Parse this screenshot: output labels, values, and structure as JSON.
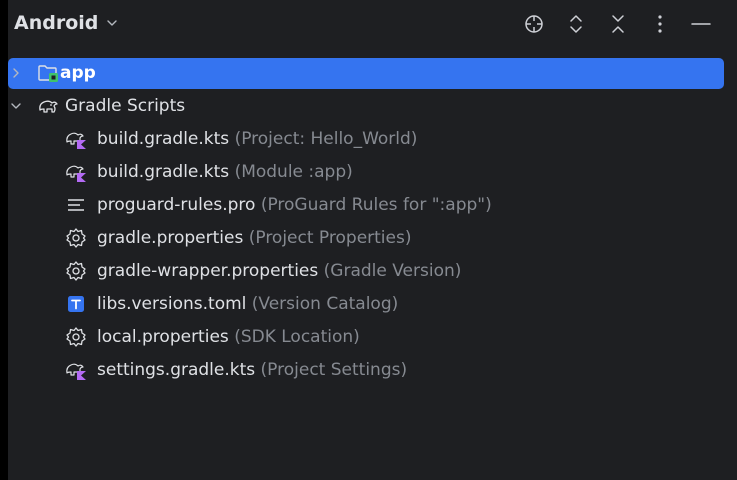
{
  "header": {
    "view_title": "Android",
    "toolbar": [
      {
        "icon": "locate-target-icon"
      },
      {
        "icon": "expand-all-icon"
      },
      {
        "icon": "collapse-all-icon"
      },
      {
        "icon": "more-options-icon"
      },
      {
        "icon": "minimize-icon"
      }
    ]
  },
  "tree": {
    "app": {
      "name": "app",
      "icon": "module-folder-icon",
      "expanded": false,
      "selected": true
    },
    "gradle_scripts": {
      "name": "Gradle Scripts",
      "icon": "gradle-elephant-icon",
      "expanded": true
    },
    "files": [
      {
        "name": "build.gradle.kts",
        "hint": "(Project: Hello_World)",
        "icon": "gradle-kotlin-icon"
      },
      {
        "name": "build.gradle.kts",
        "hint": "(Module :app)",
        "icon": "gradle-kotlin-icon"
      },
      {
        "name": "proguard-rules.pro",
        "hint": "(ProGuard Rules for \":app\")",
        "icon": "text-lines-icon"
      },
      {
        "name": "gradle.properties",
        "hint": "(Project Properties)",
        "icon": "gear-icon"
      },
      {
        "name": "gradle-wrapper.properties",
        "hint": "(Gradle Version)",
        "icon": "gear-icon"
      },
      {
        "name": "libs.versions.toml",
        "hint": "(Version Catalog)",
        "icon": "toml-icon"
      },
      {
        "name": "local.properties",
        "hint": "(SDK Location)",
        "icon": "gear-icon"
      },
      {
        "name": "settings.gradle.kts",
        "hint": "(Project Settings)",
        "icon": "gradle-kotlin-icon"
      }
    ]
  },
  "colors": {
    "background": "#1e1f22",
    "selection": "#3574f0",
    "text": "#dfe1e5",
    "hint": "#868a91",
    "kotlin_accent": "#b46bf5",
    "module_badge": "#3fc36b",
    "toml_badge": "#3574f0"
  }
}
